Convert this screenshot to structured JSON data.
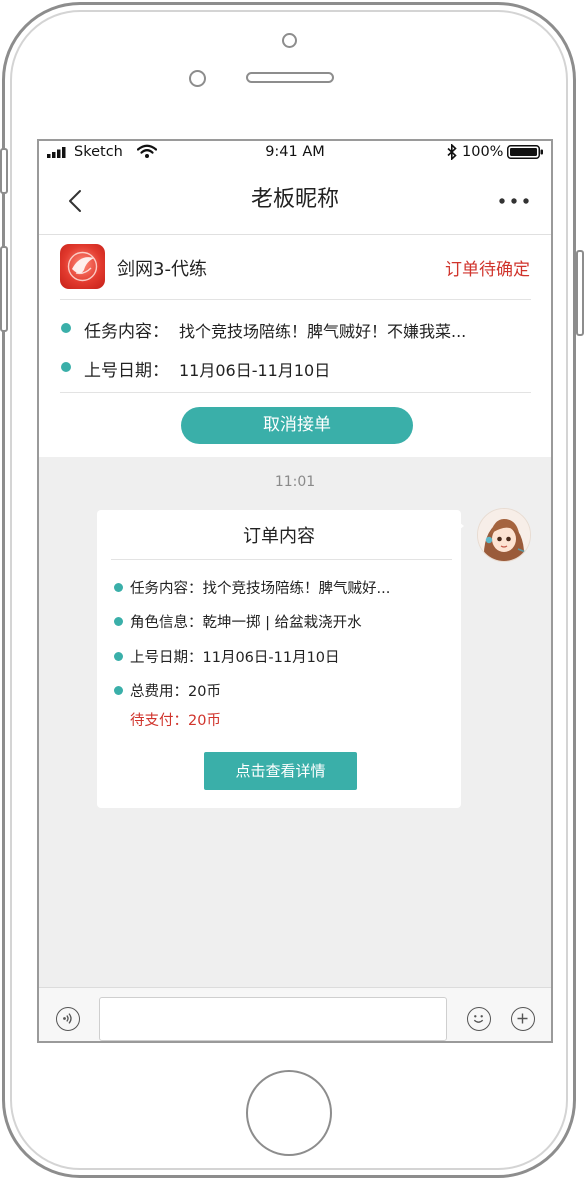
{
  "status_bar": {
    "carrier": "Sketch",
    "time": "9:41 AM",
    "battery": "100%"
  },
  "nav": {
    "title": "老板昵称"
  },
  "order": {
    "game_name": "剑网3-代练",
    "status": "订单待确定",
    "task_label": "任务内容：",
    "task_value": "找个竞技场陪练！脾气贼好！不嫌我菜...",
    "date_label": "上号日期：",
    "date_value": "11月06日-11月10日",
    "cancel_label": "取消接单"
  },
  "chat": {
    "timestamp": "11:01",
    "card": {
      "title": "订单内容",
      "task": "任务内容：找个竞技场陪练！脾气贼好...",
      "role": "角色信息：乾坤一掷 | 给盆栽浇开水",
      "date": "上号日期：11月06日-11月10日",
      "fee": "总费用：20币",
      "pending": "待支付：20币",
      "detail_label": "点击查看详情"
    }
  },
  "input": {
    "placeholder": ""
  },
  "colors": {
    "accent": "#3aafa9",
    "status_red": "#d0342c",
    "background": "#efefef"
  },
  "icons": [
    "signal-icon",
    "wifi-icon",
    "bluetooth-icon",
    "battery-icon",
    "back-arrow-icon",
    "more-icon",
    "game-logo-icon",
    "voice-icon",
    "emoji-icon",
    "add-icon"
  ]
}
